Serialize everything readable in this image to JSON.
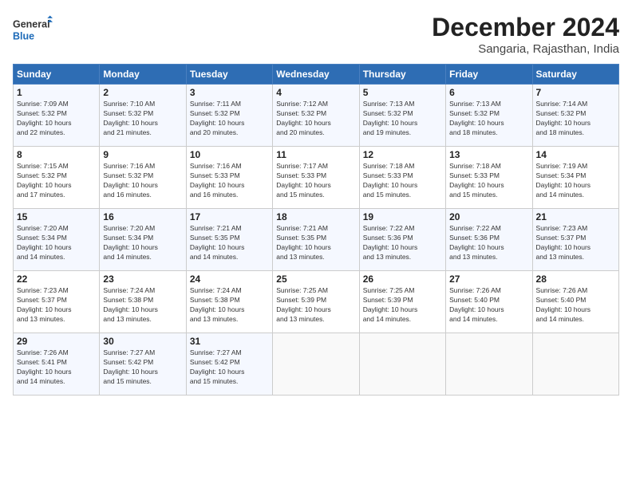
{
  "logo": {
    "line1": "General",
    "line2": "Blue"
  },
  "title": "December 2024",
  "subtitle": "Sangaria, Rajasthan, India",
  "days_header": [
    "Sunday",
    "Monday",
    "Tuesday",
    "Wednesday",
    "Thursday",
    "Friday",
    "Saturday"
  ],
  "weeks": [
    [
      {
        "day": "1",
        "info": "Sunrise: 7:09 AM\nSunset: 5:32 PM\nDaylight: 10 hours\nand 22 minutes."
      },
      {
        "day": "2",
        "info": "Sunrise: 7:10 AM\nSunset: 5:32 PM\nDaylight: 10 hours\nand 21 minutes."
      },
      {
        "day": "3",
        "info": "Sunrise: 7:11 AM\nSunset: 5:32 PM\nDaylight: 10 hours\nand 20 minutes."
      },
      {
        "day": "4",
        "info": "Sunrise: 7:12 AM\nSunset: 5:32 PM\nDaylight: 10 hours\nand 20 minutes."
      },
      {
        "day": "5",
        "info": "Sunrise: 7:13 AM\nSunset: 5:32 PM\nDaylight: 10 hours\nand 19 minutes."
      },
      {
        "day": "6",
        "info": "Sunrise: 7:13 AM\nSunset: 5:32 PM\nDaylight: 10 hours\nand 18 minutes."
      },
      {
        "day": "7",
        "info": "Sunrise: 7:14 AM\nSunset: 5:32 PM\nDaylight: 10 hours\nand 18 minutes."
      }
    ],
    [
      {
        "day": "8",
        "info": "Sunrise: 7:15 AM\nSunset: 5:32 PM\nDaylight: 10 hours\nand 17 minutes."
      },
      {
        "day": "9",
        "info": "Sunrise: 7:16 AM\nSunset: 5:32 PM\nDaylight: 10 hours\nand 16 minutes."
      },
      {
        "day": "10",
        "info": "Sunrise: 7:16 AM\nSunset: 5:33 PM\nDaylight: 10 hours\nand 16 minutes."
      },
      {
        "day": "11",
        "info": "Sunrise: 7:17 AM\nSunset: 5:33 PM\nDaylight: 10 hours\nand 15 minutes."
      },
      {
        "day": "12",
        "info": "Sunrise: 7:18 AM\nSunset: 5:33 PM\nDaylight: 10 hours\nand 15 minutes."
      },
      {
        "day": "13",
        "info": "Sunrise: 7:18 AM\nSunset: 5:33 PM\nDaylight: 10 hours\nand 15 minutes."
      },
      {
        "day": "14",
        "info": "Sunrise: 7:19 AM\nSunset: 5:34 PM\nDaylight: 10 hours\nand 14 minutes."
      }
    ],
    [
      {
        "day": "15",
        "info": "Sunrise: 7:20 AM\nSunset: 5:34 PM\nDaylight: 10 hours\nand 14 minutes."
      },
      {
        "day": "16",
        "info": "Sunrise: 7:20 AM\nSunset: 5:34 PM\nDaylight: 10 hours\nand 14 minutes."
      },
      {
        "day": "17",
        "info": "Sunrise: 7:21 AM\nSunset: 5:35 PM\nDaylight: 10 hours\nand 14 minutes."
      },
      {
        "day": "18",
        "info": "Sunrise: 7:21 AM\nSunset: 5:35 PM\nDaylight: 10 hours\nand 13 minutes."
      },
      {
        "day": "19",
        "info": "Sunrise: 7:22 AM\nSunset: 5:36 PM\nDaylight: 10 hours\nand 13 minutes."
      },
      {
        "day": "20",
        "info": "Sunrise: 7:22 AM\nSunset: 5:36 PM\nDaylight: 10 hours\nand 13 minutes."
      },
      {
        "day": "21",
        "info": "Sunrise: 7:23 AM\nSunset: 5:37 PM\nDaylight: 10 hours\nand 13 minutes."
      }
    ],
    [
      {
        "day": "22",
        "info": "Sunrise: 7:23 AM\nSunset: 5:37 PM\nDaylight: 10 hours\nand 13 minutes."
      },
      {
        "day": "23",
        "info": "Sunrise: 7:24 AM\nSunset: 5:38 PM\nDaylight: 10 hours\nand 13 minutes."
      },
      {
        "day": "24",
        "info": "Sunrise: 7:24 AM\nSunset: 5:38 PM\nDaylight: 10 hours\nand 13 minutes."
      },
      {
        "day": "25",
        "info": "Sunrise: 7:25 AM\nSunset: 5:39 PM\nDaylight: 10 hours\nand 13 minutes."
      },
      {
        "day": "26",
        "info": "Sunrise: 7:25 AM\nSunset: 5:39 PM\nDaylight: 10 hours\nand 14 minutes."
      },
      {
        "day": "27",
        "info": "Sunrise: 7:26 AM\nSunset: 5:40 PM\nDaylight: 10 hours\nand 14 minutes."
      },
      {
        "day": "28",
        "info": "Sunrise: 7:26 AM\nSunset: 5:40 PM\nDaylight: 10 hours\nand 14 minutes."
      }
    ],
    [
      {
        "day": "29",
        "info": "Sunrise: 7:26 AM\nSunset: 5:41 PM\nDaylight: 10 hours\nand 14 minutes."
      },
      {
        "day": "30",
        "info": "Sunrise: 7:27 AM\nSunset: 5:42 PM\nDaylight: 10 hours\nand 15 minutes."
      },
      {
        "day": "31",
        "info": "Sunrise: 7:27 AM\nSunset: 5:42 PM\nDaylight: 10 hours\nand 15 minutes."
      },
      {
        "day": "",
        "info": ""
      },
      {
        "day": "",
        "info": ""
      },
      {
        "day": "",
        "info": ""
      },
      {
        "day": "",
        "info": ""
      }
    ]
  ]
}
